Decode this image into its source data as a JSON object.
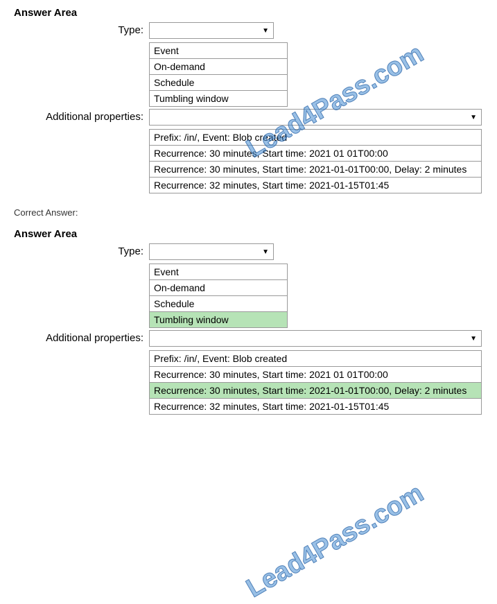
{
  "headers": {
    "answer_area": "Answer Area",
    "correct_answer": "Correct Answer:"
  },
  "labels": {
    "type": "Type:",
    "additional_properties": "Additional properties:"
  },
  "type_options": [
    "Event",
    "On-demand",
    "Schedule",
    "Tumbling window"
  ],
  "additional_options": [
    "Prefix: /in/, Event: Blob created",
    "Recurrence: 30 minutes, Start time: 2021 01 01T00:00",
    "Recurrence: 30 minutes, Start time: 2021-01-01T00:00, Delay: 2 minutes",
    "Recurrence: 32 minutes, Start time: 2021-01-15T01:45"
  ],
  "watermark": "Lead4Pass.com",
  "correct": {
    "type_index": 3,
    "additional_index": 2
  }
}
